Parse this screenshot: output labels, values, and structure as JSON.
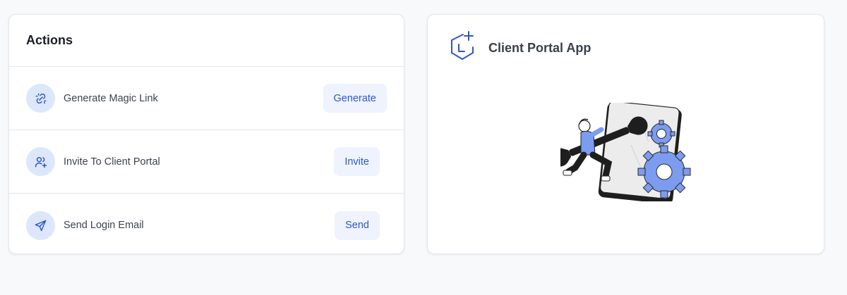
{
  "actions": {
    "title": "Actions",
    "items": [
      {
        "label": "Generate Magic Link",
        "icon": "magic-link-icon",
        "button": "Generate"
      },
      {
        "label": "Invite To Client Portal",
        "icon": "user-plus-icon",
        "button": "Invite"
      },
      {
        "label": "Send Login Email",
        "icon": "send-icon",
        "button": "Send"
      }
    ]
  },
  "portal": {
    "title": "Client Portal App",
    "logo_icon": "portal-logo-icon",
    "illustration": "maintenance-illustration"
  },
  "colors": {
    "background": "#f8f9fb",
    "card": "#ffffff",
    "accent": "#2f56c7",
    "icon_bg": "#dde7fb",
    "button_bg": "#eef3fd",
    "gear": "#7c9cf0"
  }
}
